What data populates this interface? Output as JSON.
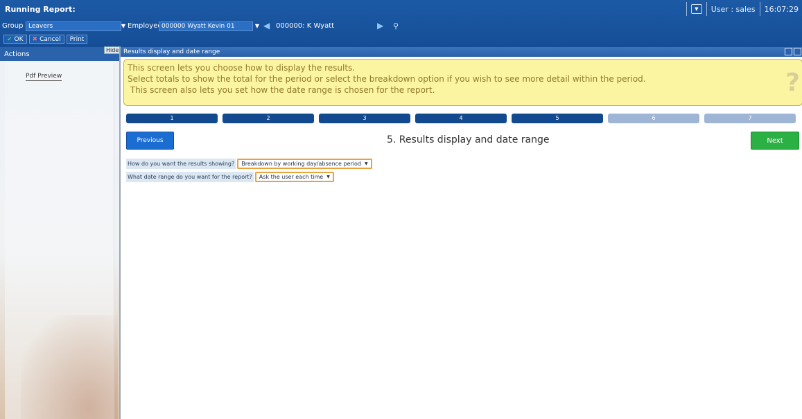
{
  "app": {
    "title": "Running Report:",
    "user": "User : sales",
    "time": "16:07:29"
  },
  "toolbar": {
    "group_label": "Group",
    "group_value": "Leavers",
    "employee_label": "Employee",
    "employee_value": "000000  Wyatt  Kevin  01",
    "employee_display": "000000: K Wyatt",
    "ok_label": "OK",
    "cancel_label": "Cancel",
    "print_label": "Print"
  },
  "actions": {
    "header": "Actions",
    "hide_label": "Hide",
    "items": [
      "Pdf Preview"
    ]
  },
  "main": {
    "header": "Results display and date range",
    "info_lines": [
      "This screen lets you choose how to display the results.",
      "Select totals to show the total for the period or select the breakdown option if you wish to see more detail within the period.",
      " This screen also lets you set how the date range is chosen for the report."
    ],
    "help_mark": "?",
    "steps": [
      {
        "label": "1",
        "state": "done"
      },
      {
        "label": "2",
        "state": "done"
      },
      {
        "label": "3",
        "state": "done"
      },
      {
        "label": "4",
        "state": "done"
      },
      {
        "label": "5",
        "state": "done"
      },
      {
        "label": "6",
        "state": "todo"
      },
      {
        "label": "7",
        "state": "todo"
      }
    ],
    "previous_label": "Previous",
    "step_title": "5. Results display and date range",
    "next_label": "Next",
    "questions": [
      {
        "label": "How do you want the results showing?",
        "value": "Breakdown by working day/absence period"
      },
      {
        "label": "What date range do you want for the report?",
        "value": "Ask the user each time"
      }
    ]
  },
  "colors": {
    "header_blue": "#1c5aa6",
    "step_done": "#12498f",
    "step_todo": "#9fb5d6",
    "next_green": "#2ab043",
    "info_yellow": "#fbf5a2",
    "select_border": "#e8a23c"
  }
}
